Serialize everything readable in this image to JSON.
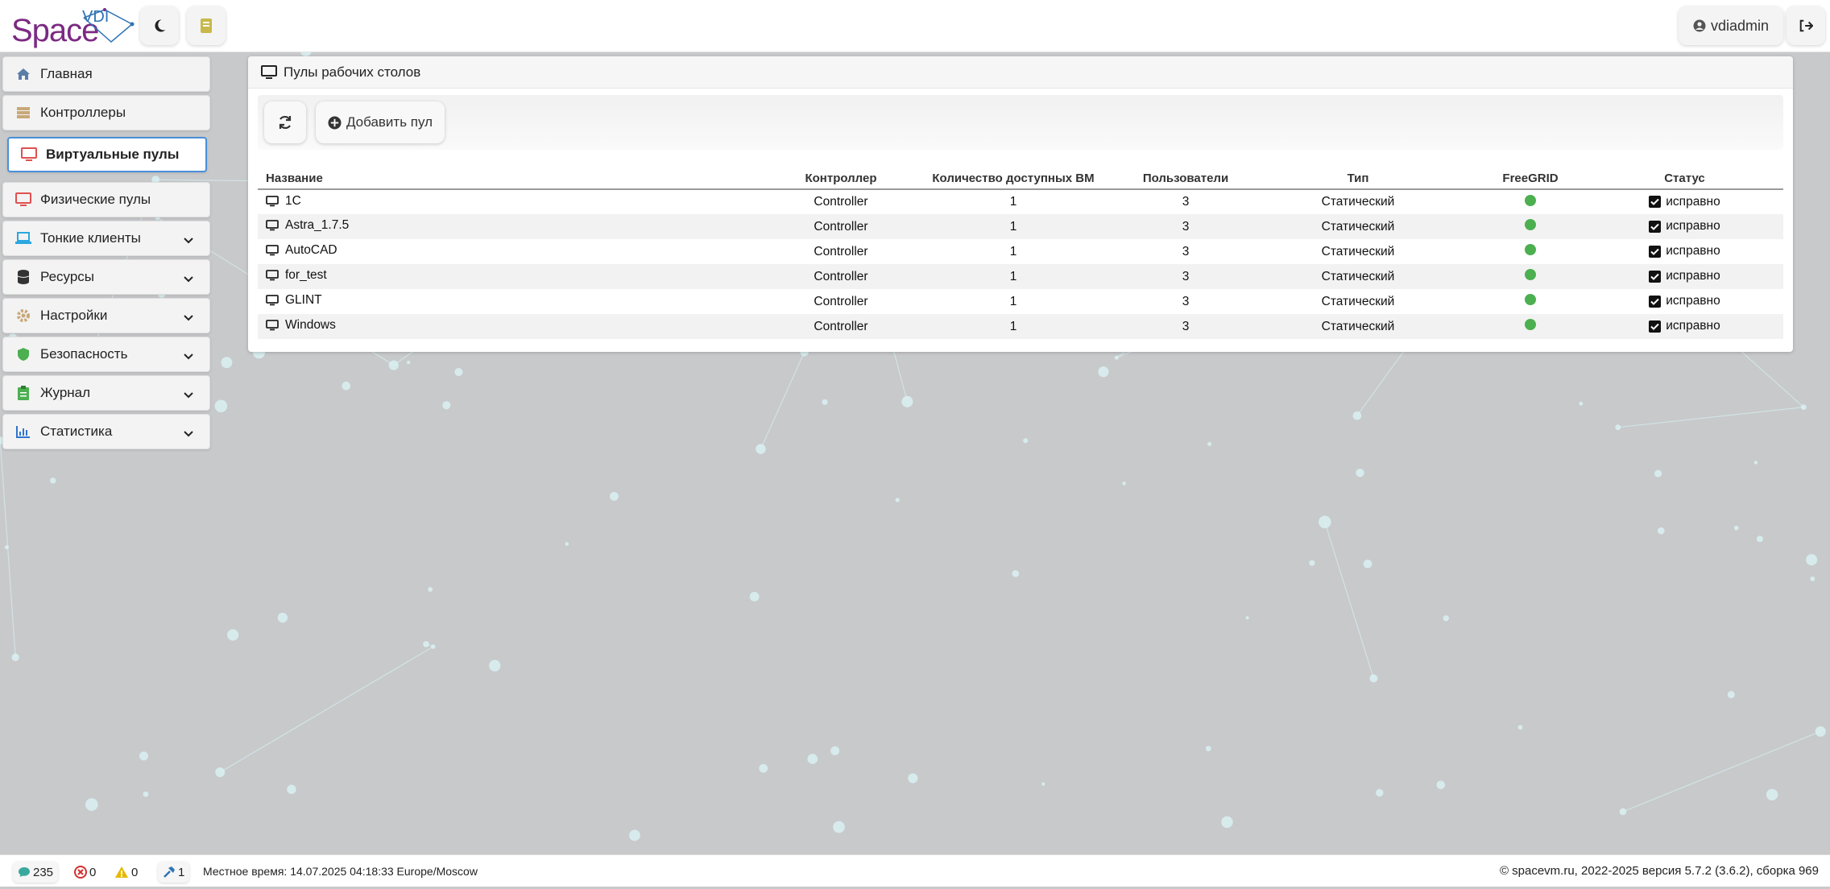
{
  "app": {
    "logo_text": "Space",
    "logo_vdi": "VDI"
  },
  "header": {
    "user_name": "vdiadmin",
    "icons": [
      "moon-icon",
      "book-icon",
      "user-circle-icon",
      "sign-out-icon"
    ]
  },
  "sidebar": {
    "items": [
      {
        "label": "Главная",
        "icon": "home-icon",
        "color": "#5a7ea8"
      },
      {
        "label": "Контроллеры",
        "icon": "server-icon",
        "color": "#c8a878"
      },
      {
        "label": "Виртуальные пулы",
        "icon": "desktop-icon",
        "color": "#e05050"
      },
      {
        "label": "Физические пулы",
        "icon": "desktop-icon",
        "color": "#e05050"
      },
      {
        "label": "Тонкие клиенты",
        "icon": "laptop-icon",
        "color": "#2aa8e0"
      },
      {
        "label": "Ресурсы",
        "icon": "database-icon",
        "color": "#333333"
      },
      {
        "label": "Настройки",
        "icon": "gear-icon",
        "color": "#c8a878"
      },
      {
        "label": "Безопасность",
        "icon": "shield-icon",
        "color": "#4caf50"
      },
      {
        "label": "Журнал",
        "icon": "clipboard-icon",
        "color": "#4caf50"
      },
      {
        "label": "Статистика",
        "icon": "chart-icon",
        "color": "#2f74d0"
      }
    ]
  },
  "panel": {
    "title": "Пулы рабочих столов",
    "add_label": "Добавить пул"
  },
  "table": {
    "headers": {
      "name": "Название",
      "controller": "Контроллер",
      "vm_count": "Количество доступных ВМ",
      "users": "Пользователи",
      "type": "Тип",
      "freegrid": "FreeGRID",
      "status": "Статус"
    },
    "rows": [
      {
        "name": "1C",
        "controller": "Controller",
        "vm_count": "1",
        "users": "3",
        "type": "Статический",
        "status": "исправно"
      },
      {
        "name": "Astra_1.7.5",
        "controller": "Controller",
        "vm_count": "1",
        "users": "3",
        "type": "Статический",
        "status": "исправно"
      },
      {
        "name": "AutoCAD",
        "controller": "Controller",
        "vm_count": "1",
        "users": "3",
        "type": "Статический",
        "status": "исправно"
      },
      {
        "name": "for_test",
        "controller": "Controller",
        "vm_count": "1",
        "users": "3",
        "type": "Статический",
        "status": "исправно"
      },
      {
        "name": "GLINT",
        "controller": "Controller",
        "vm_count": "1",
        "users": "3",
        "type": "Статический",
        "status": "исправно"
      },
      {
        "name": "Windows",
        "controller": "Controller",
        "vm_count": "1",
        "users": "3",
        "type": "Статический",
        "status": "исправно"
      }
    ],
    "freegrid_color": "#4caf50"
  },
  "footer": {
    "messages": "235",
    "errors": "0",
    "warnings": "0",
    "tasks": "1",
    "local_time": "Местное время: 14.07.2025 04:18:33 Europe/Moscow",
    "copyright": "© spacevm.ru, 2022-2025 версия 5.7.2 (3.6.2), сборка 969"
  }
}
